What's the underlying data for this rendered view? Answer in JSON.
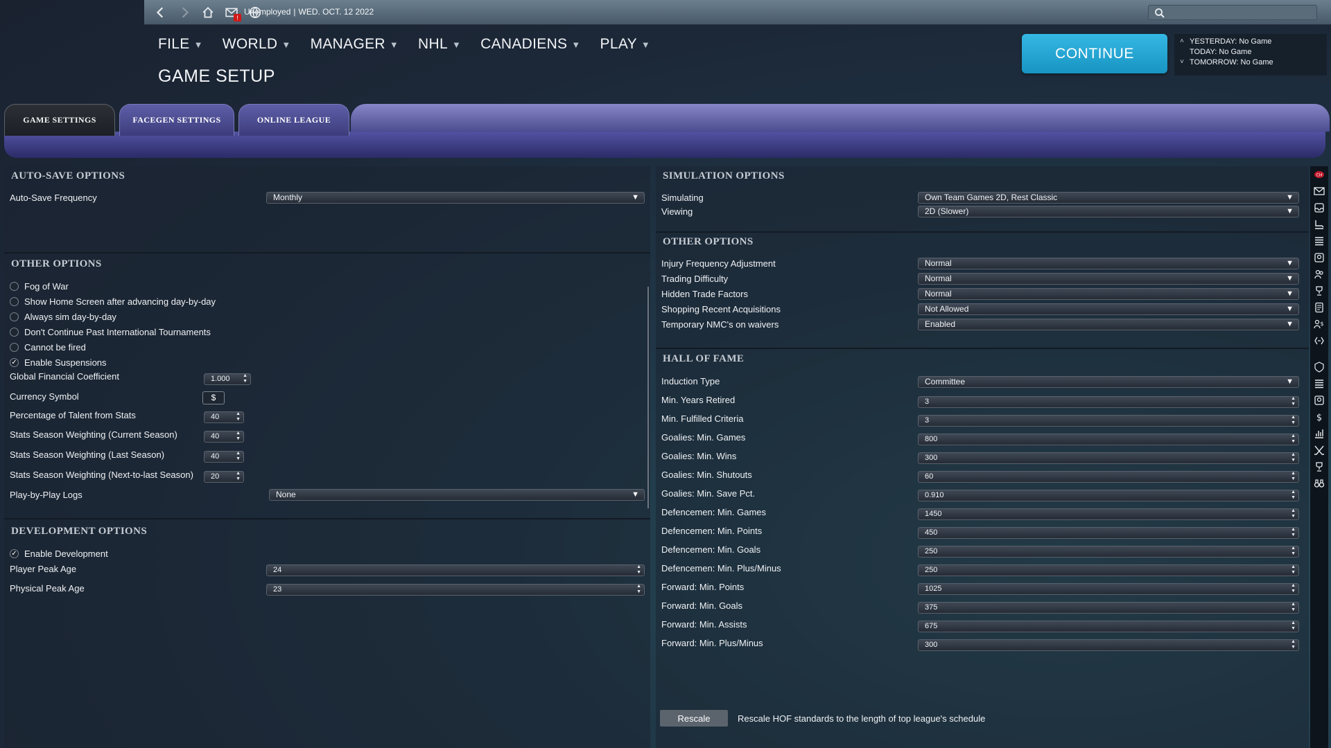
{
  "topbar": {
    "status": "Unemployed",
    "date": "WED. OCT. 12 2022",
    "mail_badge": "!",
    "search_placeholder": ""
  },
  "menu": [
    {
      "label": "FILE"
    },
    {
      "label": "WORLD"
    },
    {
      "label": "MANAGER"
    },
    {
      "label": "NHL"
    },
    {
      "label": "CANADIENS"
    },
    {
      "label": "PLAY"
    }
  ],
  "page_title": "GAME SETUP",
  "continue_label": "CONTINUE",
  "schedule": {
    "yesterday": "YESTERDAY: No Game",
    "today": "TODAY: No Game",
    "tomorrow": "TOMORROW: No Game"
  },
  "tabs": [
    "GAME SETTINGS",
    "FACEGEN SETTINGS",
    "ONLINE LEAGUE"
  ],
  "autosave": {
    "header": "AUTO-SAVE OPTIONS",
    "frequency_label": "Auto-Save Frequency",
    "frequency_value": "Monthly"
  },
  "other_left": {
    "header": "OTHER OPTIONS",
    "checks": [
      {
        "label": "Fog of War",
        "checked": false
      },
      {
        "label": "Show Home Screen after advancing day-by-day",
        "checked": false
      },
      {
        "label": "Always sim day-by-day",
        "checked": false
      },
      {
        "label": "Don't Continue Past International Tournaments",
        "checked": false
      },
      {
        "label": "Cannot be fired",
        "checked": false
      },
      {
        "label": "Enable Suspensions",
        "checked": true
      }
    ],
    "gfc_label": "Global Financial Coefficient",
    "gfc_value": "1.000",
    "currency_label": "Currency Symbol",
    "currency_value": "$",
    "talent_label": "Percentage of Talent from Stats",
    "talent_value": "40",
    "cur_season_label": "Stats Season Weighting (Current Season)",
    "cur_season_value": "40",
    "last_season_label": "Stats Season Weighting (Last Season)",
    "last_season_value": "40",
    "ntl_season_label": "Stats Season Weighting (Next-to-last Season)",
    "ntl_season_value": "20",
    "pbp_label": "Play-by-Play Logs",
    "pbp_value": "None"
  },
  "development": {
    "header": "DEVELOPMENT OPTIONS",
    "enable_label": "Enable Development",
    "enable_checked": true,
    "player_peak_label": "Player Peak Age",
    "player_peak_value": "24",
    "physical_peak_label": "Physical Peak Age",
    "physical_peak_value": "23"
  },
  "simulation": {
    "header": "SIMULATION OPTIONS",
    "simulating_label": "Simulating",
    "simulating_value": "Own Team Games 2D, Rest Classic",
    "viewing_label": "Viewing",
    "viewing_value": "2D (Slower)"
  },
  "other_right": {
    "header": "OTHER OPTIONS",
    "rows": [
      {
        "label": "Injury Frequency Adjustment",
        "value": "Normal"
      },
      {
        "label": "Trading Difficulty",
        "value": "Normal"
      },
      {
        "label": "Hidden Trade Factors",
        "value": "Normal"
      },
      {
        "label": "Shopping Recent Acquisitions",
        "value": "Not Allowed"
      },
      {
        "label": "Temporary NMC's on waivers",
        "value": "Enabled"
      }
    ]
  },
  "hof": {
    "header": "HALL OF FAME",
    "induction_label": "Induction Type",
    "induction_value": "Committee",
    "rows": [
      {
        "label": "Min. Years Retired",
        "value": "3"
      },
      {
        "label": "Min. Fulfilled Criteria",
        "value": "3"
      },
      {
        "label": "Goalies: Min. Games",
        "value": "800"
      },
      {
        "label": "Goalies: Min. Wins",
        "value": "300"
      },
      {
        "label": "Goalies: Min. Shutouts",
        "value": "60"
      },
      {
        "label": "Goalies: Min. Save Pct.",
        "value": "0.910"
      },
      {
        "label": "Defencemen: Min. Games",
        "value": "1450"
      },
      {
        "label": "Defencemen: Min. Points",
        "value": "450"
      },
      {
        "label": "Defencemen: Min. Goals",
        "value": "250"
      },
      {
        "label": "Defencemen: Min. Plus/Minus",
        "value": "250"
      },
      {
        "label": "Forward: Min. Points",
        "value": "1025"
      },
      {
        "label": "Forward: Min. Goals",
        "value": "375"
      },
      {
        "label": "Forward: Min. Assists",
        "value": "675"
      },
      {
        "label": "Forward: Min. Plus/Minus",
        "value": "300"
      }
    ],
    "rescale_label": "Rescale",
    "rescale_text": "Rescale HOF standards to the length of top league's schedule"
  },
  "rail_icons": [
    "team-logo-icon",
    "mail-icon",
    "inbox-icon",
    "skate-icon",
    "list-icon",
    "roster-icon",
    "staff-icon",
    "trophy-icon",
    "document-icon",
    "finances-icon",
    "transactions-icon",
    "league-logo-icon",
    "list-icon",
    "roster-icon",
    "dollar-icon",
    "stats-icon",
    "sticks-icon",
    "trophy-icon",
    "binoculars-icon"
  ]
}
